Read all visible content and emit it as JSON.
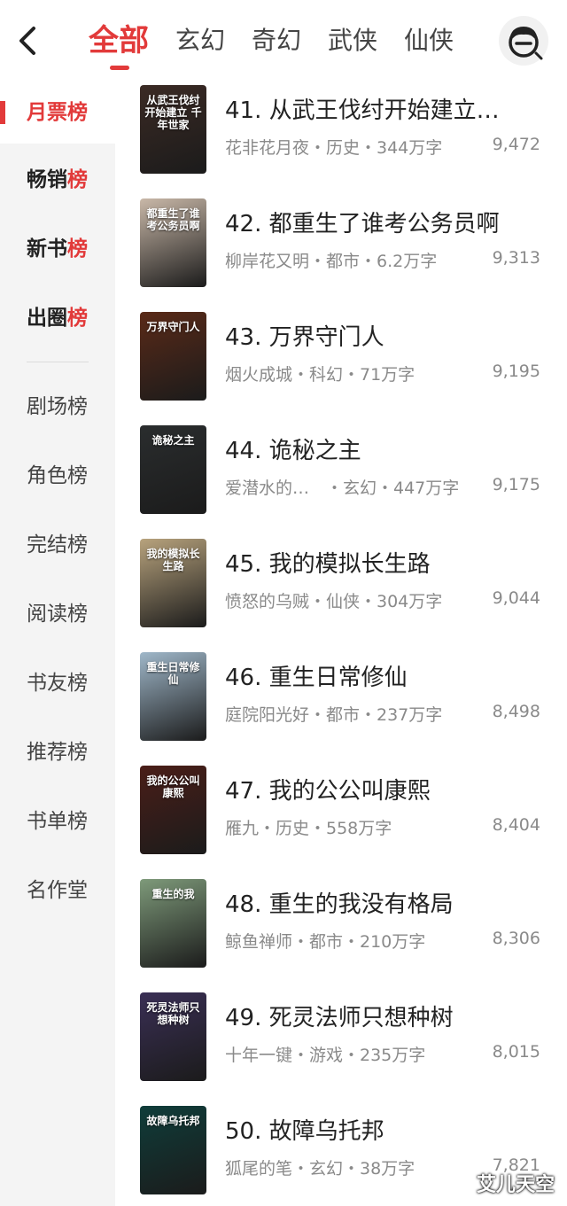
{
  "header": {
    "tabs": [
      {
        "label": "全部",
        "active": true
      },
      {
        "label": "玄幻",
        "active": false
      },
      {
        "label": "奇幻",
        "active": false
      },
      {
        "label": "武侠",
        "active": false
      },
      {
        "label": "仙侠",
        "active": false
      }
    ],
    "back_icon": "chevron-left-icon",
    "avatar_icon": "user-avatar-icon"
  },
  "sidebar": {
    "items": [
      {
        "label": "月票榜",
        "active": true
      },
      {
        "label": "畅销榜",
        "main": "畅销",
        "accent": "榜"
      },
      {
        "label": "新书榜",
        "main": "新书",
        "accent": "榜"
      },
      {
        "label": "出圈榜",
        "main": "出圈",
        "accent": "榜"
      },
      {
        "label": "剧场榜"
      },
      {
        "label": "角色榜"
      },
      {
        "label": "完结榜"
      },
      {
        "label": "阅读榜"
      },
      {
        "label": "书友榜"
      },
      {
        "label": "推荐榜"
      },
      {
        "label": "书单榜"
      },
      {
        "label": "名作堂"
      }
    ]
  },
  "books": [
    {
      "title": "41. 从武王伐纣开始建立…",
      "author": "花非花月夜",
      "genre": "历史",
      "words": "344万字",
      "meta": "花非花月夜・历史・344万字",
      "votes": "9,472",
      "cover_text": "从武王伐纣开始建立 千年世家",
      "cover_color": "#3b2a24"
    },
    {
      "title": "42. 都重生了谁考公务员啊",
      "author": "柳岸花又明",
      "genre": "都市",
      "words": "6.2万字",
      "meta": "柳岸花又明・都市・6.2万字",
      "votes": "9,313",
      "cover_text": "都重生了谁考公务员啊",
      "cover_color": "#c9b8a8"
    },
    {
      "title": "43. 万界守门人",
      "author": "烟火成城",
      "genre": "科幻",
      "words": "71万字",
      "meta": "烟火成城・科幻・71万字",
      "votes": "9,195",
      "cover_text": "万界守门人",
      "cover_color": "#5a2a18"
    },
    {
      "title": "44. 诡秘之主",
      "author": "爱潜水的…",
      "genre": "玄幻",
      "words": "447万字",
      "meta": "爱潜水的…　・玄幻・447万字",
      "votes": "9,175",
      "cover_text": "诡秘之主",
      "cover_color": "#2a2d2e"
    },
    {
      "title": "45. 我的模拟长生路",
      "author": "愤怒的乌贼",
      "genre": "仙侠",
      "words": "304万字",
      "meta": "愤怒的乌贼・仙侠・304万字",
      "votes": "9,044",
      "cover_text": "我的模拟长生路",
      "cover_color": "#b8a37d"
    },
    {
      "title": "46. 重生日常修仙",
      "author": "庭院阳光好",
      "genre": "都市",
      "words": "237万字",
      "meta": "庭院阳光好・都市・237万字",
      "votes": "8,498",
      "cover_text": "重生日常修仙",
      "cover_color": "#9fb7c9"
    },
    {
      "title": "47. 我的公公叫康熙",
      "author": "雁九",
      "genre": "历史",
      "words": "558万字",
      "meta": "雁九・历史・558万字",
      "votes": "8,404",
      "cover_text": "我的公公叫康熙",
      "cover_color": "#4a1e18"
    },
    {
      "title": "48. 重生的我没有格局",
      "author": "鲸鱼禅师",
      "genre": "都市",
      "words": "210万字",
      "meta": "鲸鱼禅师・都市・210万字",
      "votes": "8,306",
      "cover_text": "重生的我",
      "cover_color": "#7e9a7a"
    },
    {
      "title": "49. 死灵法师只想种树",
      "author": "十年一键",
      "genre": "游戏",
      "words": "235万字",
      "meta": "十年一键・游戏・235万字",
      "votes": "8,015",
      "cover_text": "死灵法师只想种树",
      "cover_color": "#3a2f55"
    },
    {
      "title": "50. 故障乌托邦",
      "author": "狐尾的笔",
      "genre": "玄幻",
      "words": "38万字",
      "meta": "狐尾的笔・玄幻・38万字",
      "votes": "7,821",
      "cover_text": "故障乌托邦",
      "cover_color": "#0f3d3a"
    }
  ],
  "watermark": "艾儿天空",
  "colors": {
    "accent": "#e23a3a",
    "sidebar_bg": "#f4f4f4",
    "muted": "#8a8a8a"
  }
}
